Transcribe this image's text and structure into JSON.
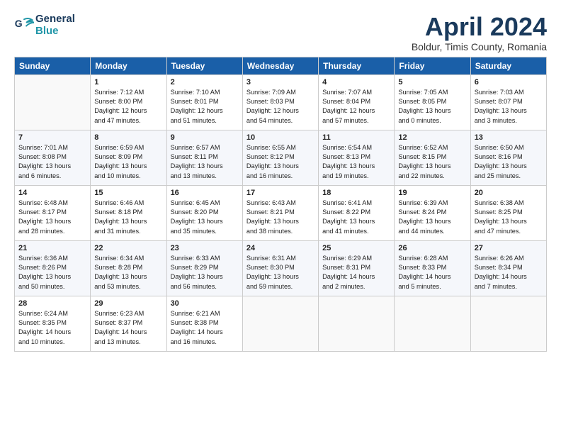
{
  "header": {
    "logo_line1": "General",
    "logo_line2": "Blue",
    "month": "April 2024",
    "location": "Boldur, Timis County, Romania"
  },
  "days_of_week": [
    "Sunday",
    "Monday",
    "Tuesday",
    "Wednesday",
    "Thursday",
    "Friday",
    "Saturday"
  ],
  "weeks": [
    [
      {
        "day": "",
        "info": ""
      },
      {
        "day": "1",
        "info": "Sunrise: 7:12 AM\nSunset: 8:00 PM\nDaylight: 12 hours\nand 47 minutes."
      },
      {
        "day": "2",
        "info": "Sunrise: 7:10 AM\nSunset: 8:01 PM\nDaylight: 12 hours\nand 51 minutes."
      },
      {
        "day": "3",
        "info": "Sunrise: 7:09 AM\nSunset: 8:03 PM\nDaylight: 12 hours\nand 54 minutes."
      },
      {
        "day": "4",
        "info": "Sunrise: 7:07 AM\nSunset: 8:04 PM\nDaylight: 12 hours\nand 57 minutes."
      },
      {
        "day": "5",
        "info": "Sunrise: 7:05 AM\nSunset: 8:05 PM\nDaylight: 13 hours\nand 0 minutes."
      },
      {
        "day": "6",
        "info": "Sunrise: 7:03 AM\nSunset: 8:07 PM\nDaylight: 13 hours\nand 3 minutes."
      }
    ],
    [
      {
        "day": "7",
        "info": "Sunrise: 7:01 AM\nSunset: 8:08 PM\nDaylight: 13 hours\nand 6 minutes."
      },
      {
        "day": "8",
        "info": "Sunrise: 6:59 AM\nSunset: 8:09 PM\nDaylight: 13 hours\nand 10 minutes."
      },
      {
        "day": "9",
        "info": "Sunrise: 6:57 AM\nSunset: 8:11 PM\nDaylight: 13 hours\nand 13 minutes."
      },
      {
        "day": "10",
        "info": "Sunrise: 6:55 AM\nSunset: 8:12 PM\nDaylight: 13 hours\nand 16 minutes."
      },
      {
        "day": "11",
        "info": "Sunrise: 6:54 AM\nSunset: 8:13 PM\nDaylight: 13 hours\nand 19 minutes."
      },
      {
        "day": "12",
        "info": "Sunrise: 6:52 AM\nSunset: 8:15 PM\nDaylight: 13 hours\nand 22 minutes."
      },
      {
        "day": "13",
        "info": "Sunrise: 6:50 AM\nSunset: 8:16 PM\nDaylight: 13 hours\nand 25 minutes."
      }
    ],
    [
      {
        "day": "14",
        "info": "Sunrise: 6:48 AM\nSunset: 8:17 PM\nDaylight: 13 hours\nand 28 minutes."
      },
      {
        "day": "15",
        "info": "Sunrise: 6:46 AM\nSunset: 8:18 PM\nDaylight: 13 hours\nand 31 minutes."
      },
      {
        "day": "16",
        "info": "Sunrise: 6:45 AM\nSunset: 8:20 PM\nDaylight: 13 hours\nand 35 minutes."
      },
      {
        "day": "17",
        "info": "Sunrise: 6:43 AM\nSunset: 8:21 PM\nDaylight: 13 hours\nand 38 minutes."
      },
      {
        "day": "18",
        "info": "Sunrise: 6:41 AM\nSunset: 8:22 PM\nDaylight: 13 hours\nand 41 minutes."
      },
      {
        "day": "19",
        "info": "Sunrise: 6:39 AM\nSunset: 8:24 PM\nDaylight: 13 hours\nand 44 minutes."
      },
      {
        "day": "20",
        "info": "Sunrise: 6:38 AM\nSunset: 8:25 PM\nDaylight: 13 hours\nand 47 minutes."
      }
    ],
    [
      {
        "day": "21",
        "info": "Sunrise: 6:36 AM\nSunset: 8:26 PM\nDaylight: 13 hours\nand 50 minutes."
      },
      {
        "day": "22",
        "info": "Sunrise: 6:34 AM\nSunset: 8:28 PM\nDaylight: 13 hours\nand 53 minutes."
      },
      {
        "day": "23",
        "info": "Sunrise: 6:33 AM\nSunset: 8:29 PM\nDaylight: 13 hours\nand 56 minutes."
      },
      {
        "day": "24",
        "info": "Sunrise: 6:31 AM\nSunset: 8:30 PM\nDaylight: 13 hours\nand 59 minutes."
      },
      {
        "day": "25",
        "info": "Sunrise: 6:29 AM\nSunset: 8:31 PM\nDaylight: 14 hours\nand 2 minutes."
      },
      {
        "day": "26",
        "info": "Sunrise: 6:28 AM\nSunset: 8:33 PM\nDaylight: 14 hours\nand 5 minutes."
      },
      {
        "day": "27",
        "info": "Sunrise: 6:26 AM\nSunset: 8:34 PM\nDaylight: 14 hours\nand 7 minutes."
      }
    ],
    [
      {
        "day": "28",
        "info": "Sunrise: 6:24 AM\nSunset: 8:35 PM\nDaylight: 14 hours\nand 10 minutes."
      },
      {
        "day": "29",
        "info": "Sunrise: 6:23 AM\nSunset: 8:37 PM\nDaylight: 14 hours\nand 13 minutes."
      },
      {
        "day": "30",
        "info": "Sunrise: 6:21 AM\nSunset: 8:38 PM\nDaylight: 14 hours\nand 16 minutes."
      },
      {
        "day": "",
        "info": ""
      },
      {
        "day": "",
        "info": ""
      },
      {
        "day": "",
        "info": ""
      },
      {
        "day": "",
        "info": ""
      }
    ]
  ]
}
